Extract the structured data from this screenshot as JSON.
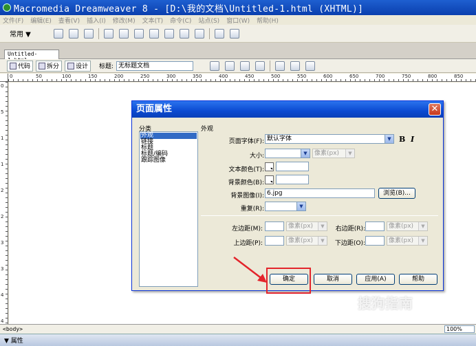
{
  "window": {
    "title": "Macromedia Dreamweaver 8 - [D:\\我的文档\\Untitled-1.html (XHTML)]"
  },
  "menu": [
    "文件(F)",
    "编辑(E)",
    "查看(V)",
    "插入(I)",
    "修改(M)",
    "文本(T)",
    "命令(C)",
    "站点(S)",
    "窗口(W)",
    "帮助(H)"
  ],
  "insert_bar": {
    "category": "常用 ▼"
  },
  "doc_tab": {
    "label": "Untitled-1.html"
  },
  "doc_toolbar": {
    "code_label": "代码",
    "split_label": "拆分",
    "design_label": "设计",
    "title_label": "标题:",
    "title_value": "无标题文档"
  },
  "ruler": {
    "h_labels": [
      "0",
      "50",
      "100",
      "150",
      "200",
      "250",
      "300",
      "350",
      "400",
      "450",
      "500",
      "550",
      "600",
      "650",
      "700",
      "750",
      "800",
      "850"
    ],
    "v_labels": [
      "0",
      "5",
      "1",
      "1",
      "2",
      "2",
      "3",
      "3",
      "4",
      "4"
    ]
  },
  "status": {
    "tag": "<body>",
    "zoom": "100%"
  },
  "properties": {
    "label": "▼ 属性"
  },
  "dialog": {
    "title": "页面属性",
    "close_glyph": "✕",
    "category_label": "分类",
    "categories": [
      "外观",
      "链接",
      "标题",
      "标题/编码",
      "跟踪图像"
    ],
    "section_label": "外观",
    "font_label": "页面字体(F):",
    "font_value": "默认字体",
    "bold": "B",
    "italic": "I",
    "size_label": "大小:",
    "size_value": "",
    "size_unit": "像素(px)",
    "text_color_label": "文本颜色(T):",
    "bg_color_label": "背景颜色(B):",
    "bg_image_label": "背景图像(I):",
    "bg_image_value": "6.jpg",
    "browse_label": "浏览(B)...",
    "repeat_label": "重复(R):",
    "left_margin_label": "左边距(M):",
    "right_margin_label": "右边距(R):",
    "top_margin_label": "上边距(P):",
    "bottom_margin_label": "下边距(O):",
    "margin_unit": "像素(px)",
    "ok_label": "确定",
    "cancel_label": "取消",
    "apply_label": "应用(A)",
    "help_label": "帮助"
  },
  "watermark": {
    "text": "搜狗指南",
    "url": "zhinan.sogou.com"
  },
  "colors": {
    "annotation": "#e3242b",
    "title_bar": "#0b4ad1",
    "selection": "#316ac5"
  }
}
